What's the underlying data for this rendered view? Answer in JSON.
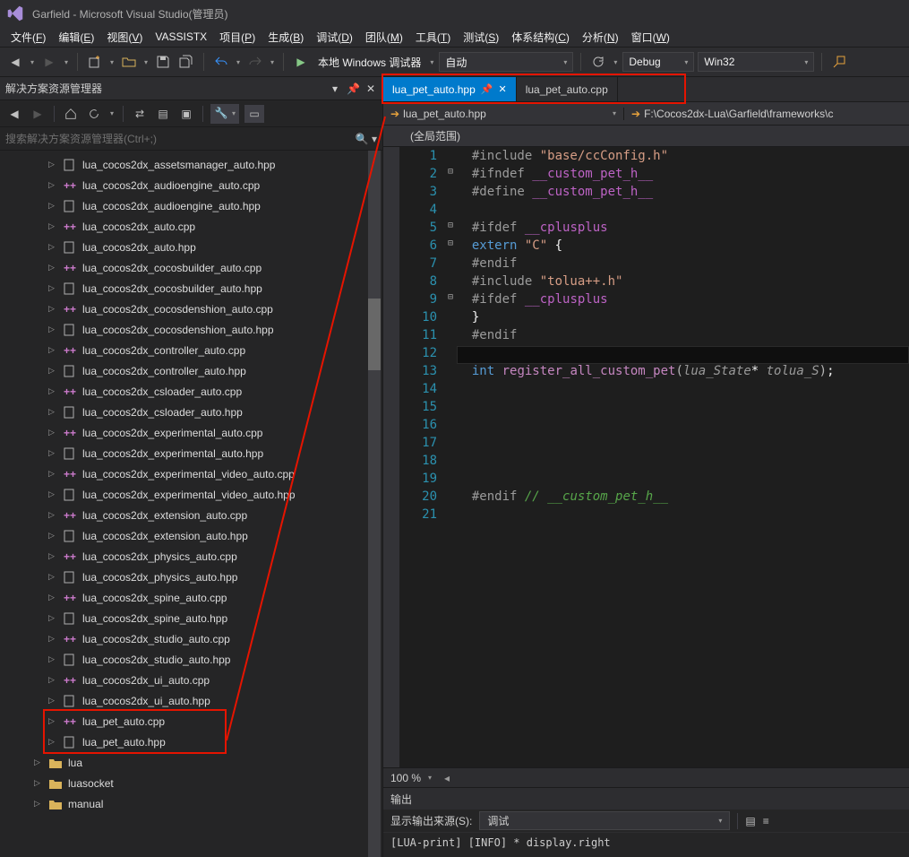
{
  "window": {
    "title": "Garfield - Microsoft Visual Studio(管理员)"
  },
  "menu": [
    "文件(F)",
    "编辑(E)",
    "视图(V)",
    "VASSISTX",
    "项目(P)",
    "生成(B)",
    "调试(D)",
    "团队(M)",
    "工具(T)",
    "测试(S)",
    "体系结构(C)",
    "分析(N)",
    "窗口(W)"
  ],
  "toolbar": {
    "debug_target": "本地 Windows 调试器",
    "combo1": "自动",
    "combo2": "Debug",
    "combo3": "Win32"
  },
  "solution_panel": {
    "title": "解决方案资源管理器",
    "search_placeholder": "搜索解决方案资源管理器(Ctrl+;)"
  },
  "tree": [
    {
      "type": "hdr",
      "name": "lua_cocos2dx_assetsmanager_auto.hpp"
    },
    {
      "type": "cpp",
      "name": "lua_cocos2dx_audioengine_auto.cpp"
    },
    {
      "type": "hdr",
      "name": "lua_cocos2dx_audioengine_auto.hpp"
    },
    {
      "type": "cpp",
      "name": "lua_cocos2dx_auto.cpp"
    },
    {
      "type": "hdr",
      "name": "lua_cocos2dx_auto.hpp"
    },
    {
      "type": "cpp",
      "name": "lua_cocos2dx_cocosbuilder_auto.cpp"
    },
    {
      "type": "hdr",
      "name": "lua_cocos2dx_cocosbuilder_auto.hpp"
    },
    {
      "type": "cpp",
      "name": "lua_cocos2dx_cocosdenshion_auto.cpp"
    },
    {
      "type": "hdr",
      "name": "lua_cocos2dx_cocosdenshion_auto.hpp"
    },
    {
      "type": "cpp",
      "name": "lua_cocos2dx_controller_auto.cpp"
    },
    {
      "type": "hdr",
      "name": "lua_cocos2dx_controller_auto.hpp"
    },
    {
      "type": "cpp",
      "name": "lua_cocos2dx_csloader_auto.cpp"
    },
    {
      "type": "hdr",
      "name": "lua_cocos2dx_csloader_auto.hpp"
    },
    {
      "type": "cpp",
      "name": "lua_cocos2dx_experimental_auto.cpp"
    },
    {
      "type": "hdr",
      "name": "lua_cocos2dx_experimental_auto.hpp"
    },
    {
      "type": "cpp",
      "name": "lua_cocos2dx_experimental_video_auto.cpp"
    },
    {
      "type": "hdr",
      "name": "lua_cocos2dx_experimental_video_auto.hpp"
    },
    {
      "type": "cpp",
      "name": "lua_cocos2dx_extension_auto.cpp"
    },
    {
      "type": "hdr",
      "name": "lua_cocos2dx_extension_auto.hpp"
    },
    {
      "type": "cpp",
      "name": "lua_cocos2dx_physics_auto.cpp"
    },
    {
      "type": "hdr",
      "name": "lua_cocos2dx_physics_auto.hpp"
    },
    {
      "type": "cpp",
      "name": "lua_cocos2dx_spine_auto.cpp"
    },
    {
      "type": "hdr",
      "name": "lua_cocos2dx_spine_auto.hpp"
    },
    {
      "type": "cpp",
      "name": "lua_cocos2dx_studio_auto.cpp"
    },
    {
      "type": "hdr",
      "name": "lua_cocos2dx_studio_auto.hpp"
    },
    {
      "type": "cpp",
      "name": "lua_cocos2dx_ui_auto.cpp"
    },
    {
      "type": "hdr",
      "name": "lua_cocos2dx_ui_auto.hpp"
    },
    {
      "type": "cpp",
      "name": "lua_pet_auto.cpp",
      "hl": true
    },
    {
      "type": "hdr",
      "name": "lua_pet_auto.hpp",
      "hl": true
    },
    {
      "type": "folder",
      "name": "lua",
      "depth": 1
    },
    {
      "type": "folder",
      "name": "luasocket",
      "depth": 1
    },
    {
      "type": "folder",
      "name": "manual",
      "depth": 1
    }
  ],
  "tabs": [
    {
      "label": "lua_pet_auto.hpp",
      "active": true,
      "pinned": true
    },
    {
      "label": "lua_pet_auto.cpp",
      "active": false
    }
  ],
  "nav": {
    "file": "lua_pet_auto.hpp",
    "path": "F:\\Cocos2dx-Lua\\Garfield\\frameworks\\c"
  },
  "scope": "(全局范围)",
  "code": {
    "lines": [
      {
        "n": 1,
        "fold": "",
        "html": "<span class='c-pp'>#include </span><span class='c-str'>\"base/ccConfig.h\"</span>"
      },
      {
        "n": 2,
        "fold": "⊟",
        "html": "<span class='c-pp'>#ifndef </span><span class='c-pp-sym'>__custom_pet_h__</span>"
      },
      {
        "n": 3,
        "fold": "",
        "html": "<span class='c-pp'>#define </span><span class='c-pp-sym'>__custom_pet_h__</span>"
      },
      {
        "n": 4,
        "fold": "",
        "html": ""
      },
      {
        "n": 5,
        "fold": "⊟",
        "html": "<span class='c-pp'>#ifdef </span><span class='c-pp-sym'>__cplusplus</span>"
      },
      {
        "n": 6,
        "fold": "⊟",
        "html": "<span class='c-key'>extern</span> <span class='c-str'>\"C\"</span> {"
      },
      {
        "n": 7,
        "fold": "",
        "html": "<span class='c-pp'>#endif</span>"
      },
      {
        "n": 8,
        "fold": "",
        "html": "<span class='c-pp'>#include </span><span class='c-str'>\"tolua++.h\"</span>"
      },
      {
        "n": 9,
        "fold": "⊟",
        "html": "<span class='c-pp'>#ifdef </span><span class='c-pp-sym'>__cplusplus</span>"
      },
      {
        "n": 10,
        "fold": "",
        "html": "}"
      },
      {
        "n": 11,
        "fold": "",
        "html": "<span class='c-pp'>#endif</span>"
      },
      {
        "n": 12,
        "fold": "",
        "html": "",
        "cur": true
      },
      {
        "n": 13,
        "fold": "",
        "html": "<span class='c-type'>int</span> <span class='c-func' style='color:#c586c0'>register_all_custom_pet</span><span class='c-paren'>(</span><span class='c-param'>lua_State</span>* <span class='c-param'>tolua_S</span><span class='c-paren'>)</span>;"
      },
      {
        "n": 14,
        "fold": "",
        "html": ""
      },
      {
        "n": 15,
        "fold": "",
        "html": ""
      },
      {
        "n": 16,
        "fold": "",
        "html": ""
      },
      {
        "n": 17,
        "fold": "",
        "html": ""
      },
      {
        "n": 18,
        "fold": "",
        "html": ""
      },
      {
        "n": 19,
        "fold": "",
        "html": ""
      },
      {
        "n": 20,
        "fold": "",
        "html": "<span class='c-pp'>#endif</span> <span class='c-comment'>// __custom_pet_h__</span>"
      },
      {
        "n": 21,
        "fold": "",
        "html": ""
      }
    ]
  },
  "zoom": "100 %",
  "output": {
    "title": "输出",
    "source_label": "显示输出来源(S):",
    "source_value": "调试",
    "body": "[LUA-print] [INFO] * display.right"
  }
}
